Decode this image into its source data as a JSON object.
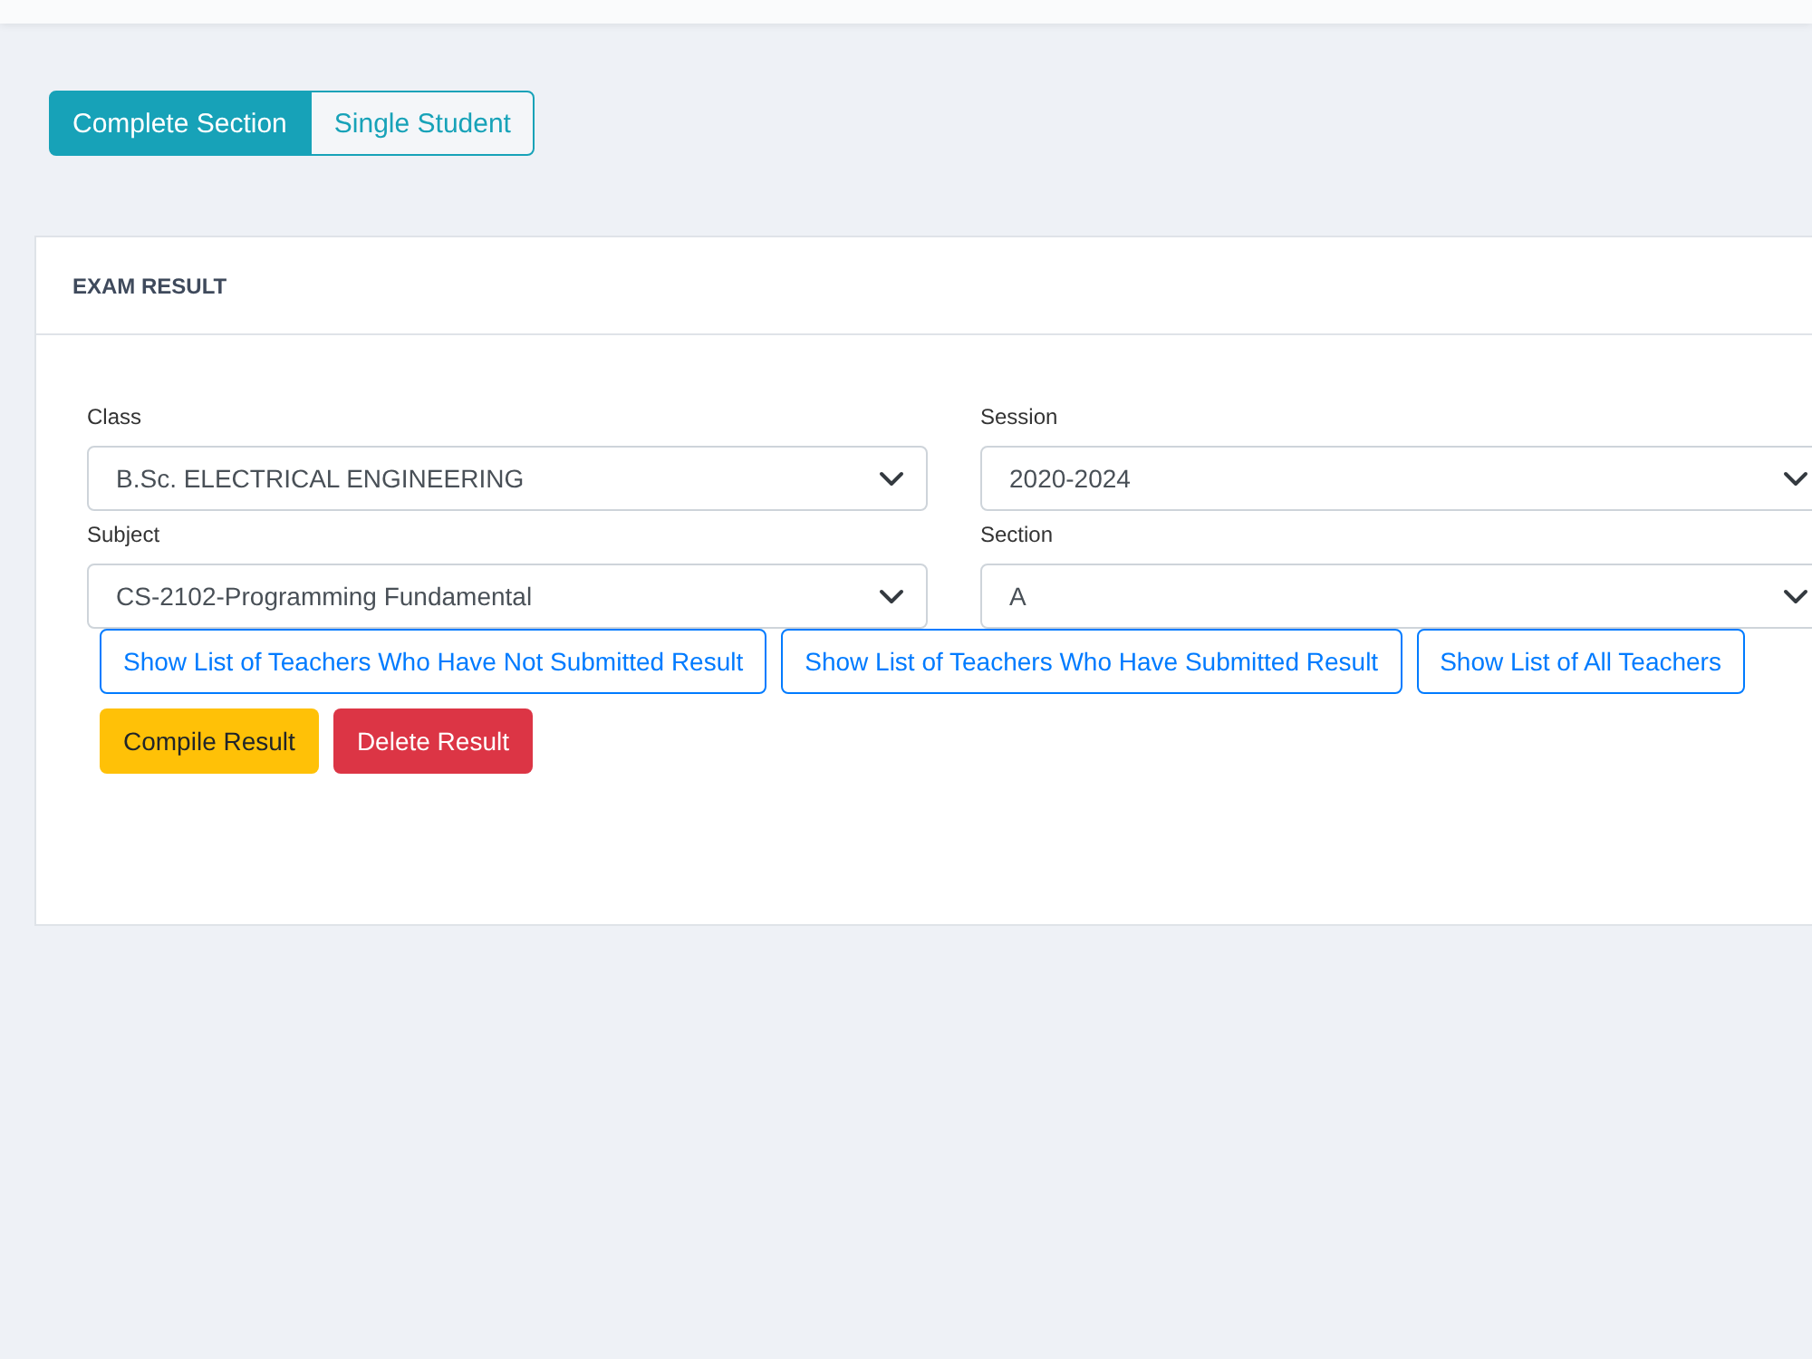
{
  "mode_tabs": [
    {
      "label": "Complete Section",
      "selected": true
    },
    {
      "label": "Single Student",
      "selected": false
    }
  ],
  "card": {
    "title": "EXAM RESULT",
    "fields": [
      {
        "label": "Class",
        "value": "B.Sc. ELECTRICAL ENGINEERING"
      },
      {
        "label": "Session",
        "value": "2020-2024"
      },
      {
        "label": "Subject",
        "value": "CS-2102-Programming Fundamental"
      },
      {
        "label": "Section",
        "value": "A"
      }
    ],
    "button_rows": [
      [
        {
          "label": "Show List of Teachers Who Have Not Submitted Result",
          "kind": "outline"
        },
        {
          "label": "Show List of Teachers Who Have Submitted Result",
          "kind": "outline"
        },
        {
          "label": "Show List of All Teachers",
          "kind": "outline"
        }
      ],
      [
        {
          "label": "Compile Result",
          "kind": "warning"
        },
        {
          "label": "Delete Result",
          "kind": "danger"
        }
      ]
    ]
  }
}
